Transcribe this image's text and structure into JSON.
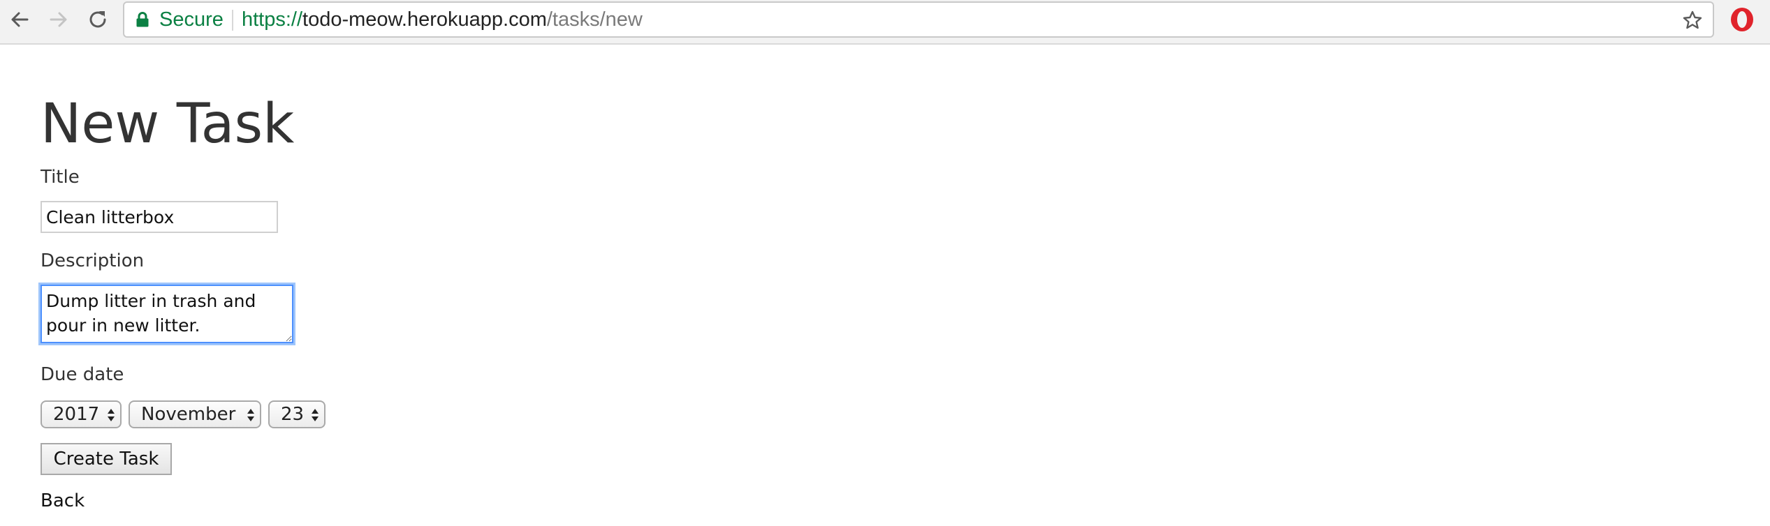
{
  "browser": {
    "secure_label": "Secure",
    "url_scheme": "https://",
    "url_host": "todo-meow.herokuapp.com",
    "url_path": "/tasks/new",
    "icons": {
      "back": "arrow-left",
      "forward": "arrow-right",
      "reload": "reload",
      "lock": "lock",
      "bookmark": "star",
      "extension": "opera-logo"
    },
    "colors": {
      "secure": "#0b8043",
      "extension": "#e0232b"
    }
  },
  "form": {
    "heading": "New Task",
    "title_label": "Title",
    "title_value": "Clean litterbox",
    "description_label": "Description",
    "description_value": "Dump litter in trash and pour in new litter.",
    "due_date_label": "Due date",
    "due_year": "2017",
    "due_month": "November",
    "due_day": "23",
    "submit_label": "Create Task",
    "back_label": "Back"
  }
}
